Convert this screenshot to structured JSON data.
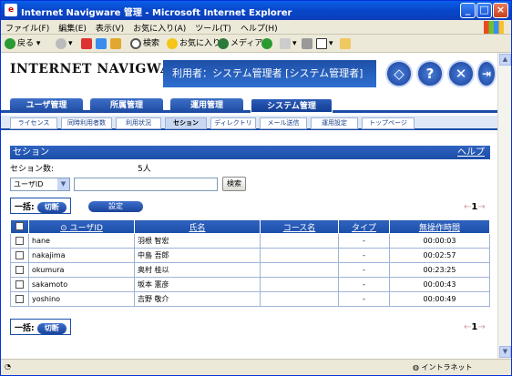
{
  "window": {
    "title": "Internet Navigware 管理 - Microsoft Internet Explorer"
  },
  "menu": [
    "ファイル(F)",
    "編集(E)",
    "表示(V)",
    "お気に入り(A)",
    "ツール(T)",
    "ヘルプ(H)"
  ],
  "toolbar": {
    "back": "戻る",
    "search": "検索",
    "favorites": "お気に入り",
    "media": "メディア"
  },
  "header": {
    "logo": "INTERNET NAVIGWARE",
    "user": "利用者：システム管理者 [システム管理者]"
  },
  "nav_tabs": [
    "ユーザ管理",
    "所属管理",
    "運用管理",
    "システム管理"
  ],
  "sub_tabs": [
    "ライセンス",
    "同時利用者数",
    "利用状況",
    "セション",
    "ディレクトリ",
    "メール送信",
    "運用設定",
    "トップページ"
  ],
  "section": {
    "title": "セション",
    "help": "ヘルプ"
  },
  "session_count": {
    "label": "セション数:",
    "value": "5人"
  },
  "search": {
    "select": "ユーザID",
    "button": "検索"
  },
  "bulk": {
    "label": "一括:",
    "disconnect": "切断",
    "settings": "設定"
  },
  "pager": {
    "page": "1"
  },
  "table": {
    "headers": [
      "ユーザID",
      "氏名",
      "コース名",
      "タイプ",
      "無操作時間"
    ],
    "rows": [
      [
        "hane",
        "羽根 智宏",
        "",
        "-",
        "00:00:03"
      ],
      [
        "nakajima",
        "中島 吾郎",
        "",
        "-",
        "00:02:57"
      ],
      [
        "okumura",
        "奥村 桂以",
        "",
        "-",
        "00:23:25"
      ],
      [
        "sakamoto",
        "坂本 憲彦",
        "",
        "-",
        "00:00:43"
      ],
      [
        "yoshino",
        "吉野 敬介",
        "",
        "-",
        "00:00:49"
      ]
    ]
  },
  "status": {
    "zone": "イントラネット"
  }
}
